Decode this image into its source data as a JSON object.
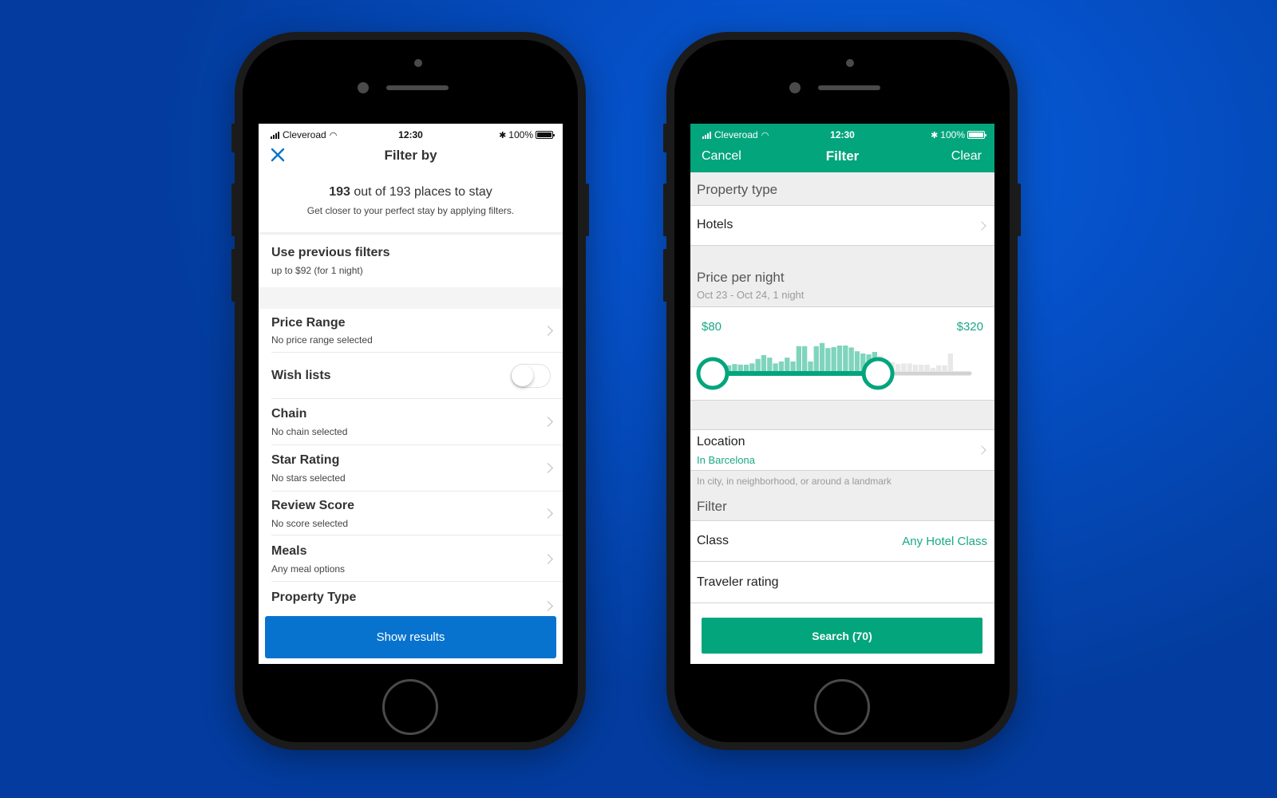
{
  "colors": {
    "left_accent": "#0773cf",
    "right_accent": "#03a57c",
    "right_value_text": "#1aa886"
  },
  "left_phone": {
    "status_bar": {
      "carrier": "Cleveroad",
      "time": "12:30",
      "battery": "100%"
    },
    "nav": {
      "close_icon": "close-icon",
      "title": "Filter by"
    },
    "summary": {
      "count_bold": "193",
      "count_rest": " out of 193 places to stay",
      "hint": "Get closer to your perfect stay by applying filters."
    },
    "previous_filters": {
      "title": "Use previous filters",
      "subtitle": "up to $92 (for 1 night)"
    },
    "filters": [
      {
        "title": "Price Range",
        "subtitle": "No price range selected",
        "type": "chevron"
      },
      {
        "title": "Wish lists",
        "subtitle": "",
        "type": "toggle",
        "on": false
      },
      {
        "title": "Chain",
        "subtitle": "No chain selected",
        "type": "chevron"
      },
      {
        "title": "Star Rating",
        "subtitle": "No stars selected",
        "type": "chevron"
      },
      {
        "title": "Review Score",
        "subtitle": "No score selected",
        "type": "chevron"
      },
      {
        "title": "Meals",
        "subtitle": "Any meal options",
        "type": "chevron"
      },
      {
        "title": "Property Type",
        "subtitle": "",
        "type": "chevron"
      }
    ],
    "show_results_label": "Show results"
  },
  "right_phone": {
    "status_bar": {
      "carrier": "Cleveroad",
      "time": "12:30",
      "battery": "100%"
    },
    "header": {
      "cancel": "Cancel",
      "title": "Filter",
      "clear": "Clear"
    },
    "property_type": {
      "section": "Property type",
      "value": "Hotels"
    },
    "price": {
      "section": "Price per night",
      "dates": "Oct 23 - Oct 24, 1 night",
      "min_label": "$80",
      "max_label": "$320",
      "range_min_fraction": 0.0,
      "range_max_fraction": 0.55,
      "histogram_relative": [
        0.18,
        0.22,
        0.2,
        0.2,
        0.24,
        0.38,
        0.5,
        0.42,
        0.24,
        0.3,
        0.42,
        0.3,
        0.78,
        0.78,
        0.3,
        0.78,
        0.88,
        0.72,
        0.75,
        0.8,
        0.8,
        0.74,
        0.62,
        0.55,
        0.52,
        0.6,
        0.48,
        0.35,
        0.28,
        0.22,
        0.24,
        0.24,
        0.2,
        0.2,
        0.2,
        0.1,
        0.18,
        0.18,
        0.55
      ]
    },
    "location": {
      "title": "Location",
      "value": "In Barcelona",
      "helper": "In city, in neighborhood, or around a landmark"
    },
    "filter_section": "Filter",
    "class": {
      "title": "Class",
      "value": "Any Hotel Class"
    },
    "traveler_rating": {
      "title": "Traveler rating"
    },
    "search_label": "Search (70)"
  }
}
